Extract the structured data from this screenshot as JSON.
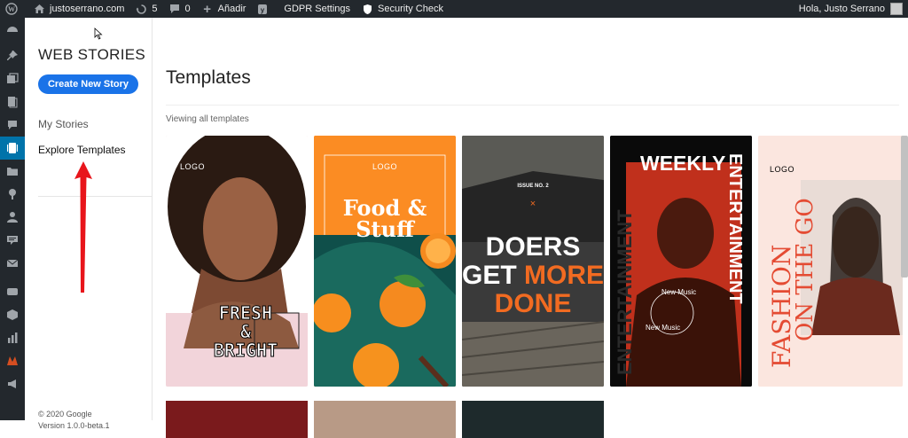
{
  "adminbar": {
    "site_name": "justoserrano.com",
    "updates_count": "5",
    "comments_count": "0",
    "add_label": "Añadir",
    "gdpr_label": "GDPR Settings",
    "security_label": "Security Check",
    "greeting": "Hola, Justo Serrano"
  },
  "nav": {
    "title": "WEB STORIES",
    "create_button": "Create New Story",
    "my_stories": "My Stories",
    "explore_templates": "Explore Templates",
    "footer_copyright": "© 2020 Google",
    "footer_version": "Version 1.0.0-beta.1"
  },
  "main": {
    "title": "Templates",
    "viewing": "Viewing all templates",
    "templates": [
      {
        "logo": "LOGO",
        "headline_1": "FRESH",
        "headline_2": "&",
        "headline_3": "BRIGHT"
      },
      {
        "logo": "LOGO",
        "headline_1": "Food &",
        "headline_2": "Stuff"
      },
      {
        "issue": "ISSUE NO. 2",
        "headline_1": "DOERS",
        "headline_2": "GET",
        "headline_3": "MORE",
        "headline_4": "DONE"
      },
      {
        "headline_1": "WEEKLY",
        "headline_2": "ENTERTAINMENT",
        "side": "ENTERTAINMENT",
        "badge_1": "New Music",
        "badge_2": "New Music"
      },
      {
        "logo": "LOGO",
        "headline_1": "FASHION",
        "headline_2": "ON THE GO"
      }
    ]
  },
  "colors": {
    "adminbar_bg": "#23282d",
    "accent_blue": "#1a73e8",
    "food_orange": "#fb8c23",
    "doers_orange": "#f26b21",
    "arrow_red": "#e8151b"
  }
}
